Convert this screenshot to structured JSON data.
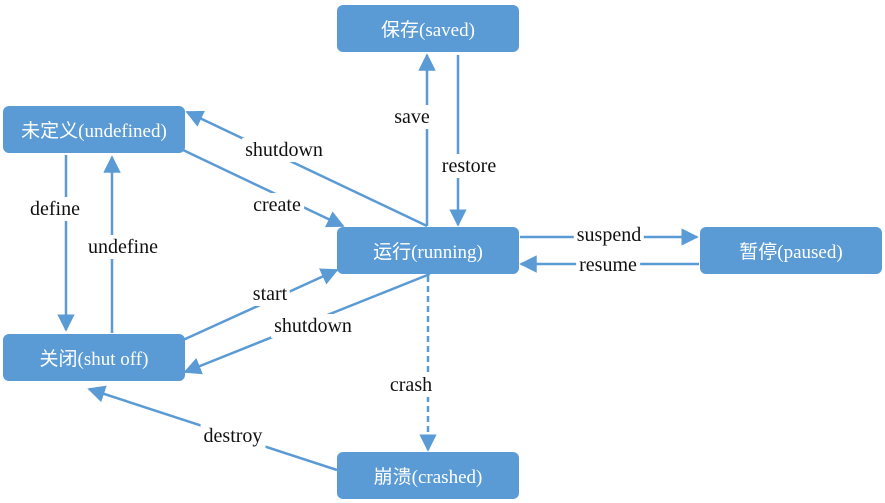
{
  "colors": {
    "node_fill": "#5b9bd5",
    "edge": "#5b9bd5",
    "node_text": "#ffffff",
    "label_text": "#111111"
  },
  "states": {
    "saved": "保存(saved)",
    "undefined": "未定义(undefined)",
    "running": "运行(running)",
    "paused": "暂停(paused)",
    "shutoff": "关闭(shut off)",
    "crashed": "崩溃(crashed)"
  },
  "transitions": {
    "save": "save",
    "restore": "restore",
    "shutdown_to_undefined": "shutdown",
    "create": "create",
    "define": "define",
    "undefine": "undefine",
    "start": "start",
    "shutdown_to_shutoff": "shutdown",
    "suspend": "suspend",
    "resume": "resume",
    "crash": "crash",
    "destroy": "destroy"
  }
}
